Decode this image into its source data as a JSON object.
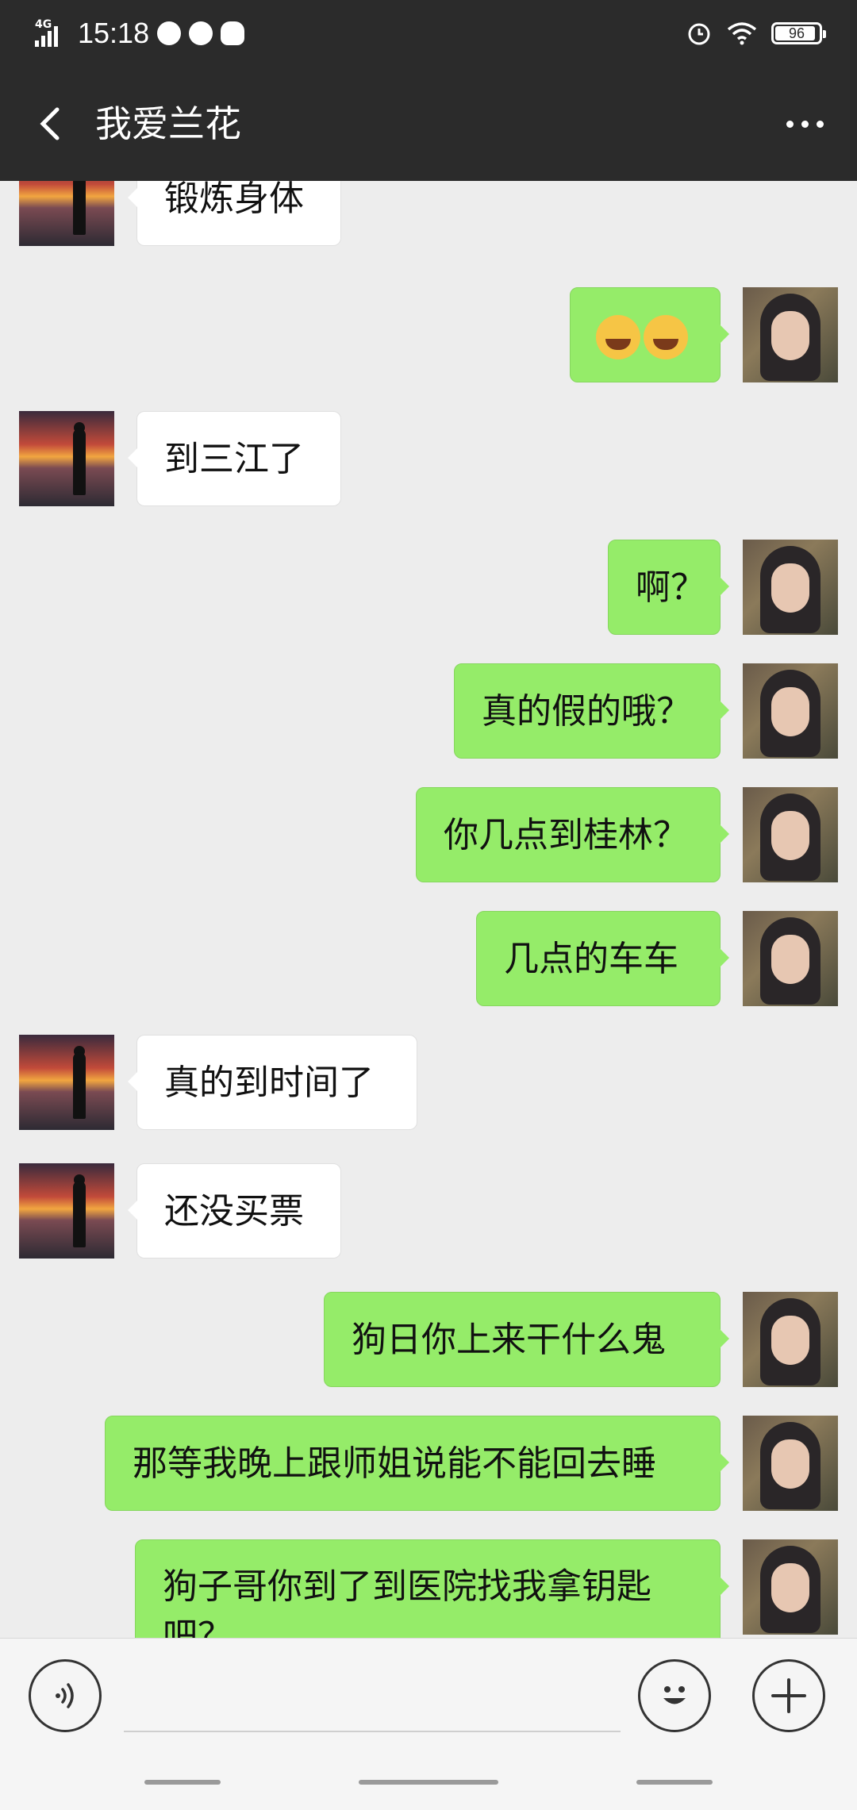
{
  "status_bar": {
    "network": "4G",
    "time": "15:18",
    "battery": "96"
  },
  "header": {
    "title": "我爱兰花"
  },
  "messages": [
    {
      "from": "other",
      "text": "锻炼身体"
    },
    {
      "from": "self",
      "text": "😂😭"
    },
    {
      "from": "other",
      "text": "到三江了"
    },
    {
      "from": "self",
      "text": "啊？"
    },
    {
      "from": "self",
      "text": "真的假的哦？"
    },
    {
      "from": "self",
      "text": "你几点到桂林？"
    },
    {
      "from": "self",
      "text": "几点的车车"
    },
    {
      "from": "other",
      "text": "真的到时间了"
    },
    {
      "from": "other",
      "text": "还没买票"
    },
    {
      "from": "self",
      "text": "狗日你上来干什么鬼"
    },
    {
      "from": "self",
      "text": "那等我晚上跟师姐说能不能回去睡"
    },
    {
      "from": "self",
      "text": "狗子哥你到了到医院找我拿钥匙吧？"
    }
  ],
  "input_bar": {
    "placeholder": ""
  },
  "icons": {
    "back": "back-arrow-icon",
    "more": "more-dots-icon",
    "voice": "voice-icon",
    "emoji": "emoji-icon",
    "plus": "plus-icon"
  },
  "colors": {
    "header_bg": "#2b2b2b",
    "chat_bg": "#ededed",
    "self_bubble": "#95ec69",
    "other_bubble": "#ffffff"
  }
}
